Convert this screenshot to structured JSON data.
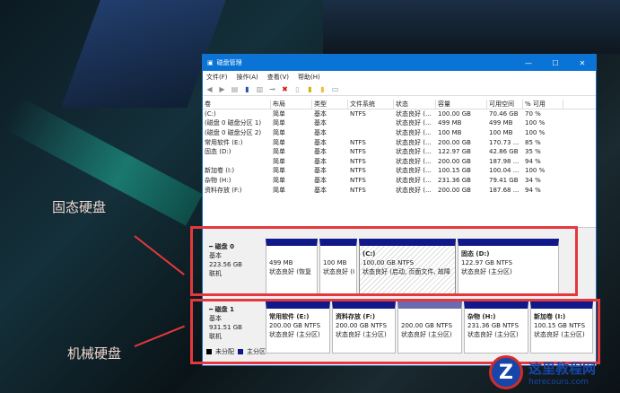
{
  "window": {
    "title": "磁盘管理",
    "controls": [
      "—",
      "☐",
      "✕"
    ]
  },
  "menu": [
    "文件(F)",
    "操作(A)",
    "查看(V)",
    "帮助(H)"
  ],
  "columns": [
    "卷",
    "布局",
    "类型",
    "文件系统",
    "状态",
    "容量",
    "可用空间",
    "% 可用"
  ],
  "volumes": [
    [
      "(C:)",
      "简单",
      "基本",
      "NTFS",
      "状态良好 (...",
      "100.00 GB",
      "70.46 GB",
      "70 %"
    ],
    [
      "(磁盘 0 磁盘分区 1)",
      "简单",
      "基本",
      "",
      "状态良好 (...",
      "499 MB",
      "499 MB",
      "100 %"
    ],
    [
      "(磁盘 0 磁盘分区 2)",
      "简单",
      "基本",
      "",
      "状态良好 (...",
      "100 MB",
      "100 MB",
      "100 %"
    ],
    [
      "常用软件 (E:)",
      "简单",
      "基本",
      "NTFS",
      "状态良好 (...",
      "200.00 GB",
      "170.73 ...",
      "85 %"
    ],
    [
      "固态 (D:)",
      "简单",
      "基本",
      "NTFS",
      "状态良好 (...",
      "122.97 GB",
      "42.86 GB",
      "35 %"
    ],
    [
      "",
      "简单",
      "基本",
      "NTFS",
      "状态良好 (...",
      "200.00 GB",
      "187.98 ...",
      "94 %"
    ],
    [
      "新加卷 (I:)",
      "简单",
      "基本",
      "NTFS",
      "状态良好 (...",
      "100.15 GB",
      "100.04 ...",
      "100 %"
    ],
    [
      "杂物 (H:)",
      "简单",
      "基本",
      "NTFS",
      "状态良好 (...",
      "231.36 GB",
      "79.41 GB",
      "34 %"
    ],
    [
      "资料存放 (F:)",
      "简单",
      "基本",
      "NTFS",
      "状态良好 (...",
      "200.00 GB",
      "187.68 ...",
      "94 %"
    ]
  ],
  "disk0": {
    "name": "磁盘 0",
    "type": "基本",
    "size": "223.56 GB",
    "status": "联机",
    "parts": [
      {
        "name": "",
        "size": "499 MB",
        "status": "状态良好 (恢复"
      },
      {
        "name": "",
        "size": "100 MB",
        "status": "状态良好 (I"
      },
      {
        "name": "(C:)",
        "size": "100.00 GB NTFS",
        "status": "状态良好 (启动, 页面文件, 故障"
      },
      {
        "name": "固态  (D:)",
        "size": "122.97 GB NTFS",
        "status": "状态良好 (主分区)"
      }
    ]
  },
  "disk1": {
    "name": "磁盘 1",
    "type": "基本",
    "size": "931.51 GB",
    "status": "联机",
    "parts": [
      {
        "name": "常用软件  (E:)",
        "size": "200.00 GB NTFS",
        "status": "状态良好 (主分区)"
      },
      {
        "name": "资料存放  (F:)",
        "size": "200.00 GB NTFS",
        "status": "状态良好 (主分区)"
      },
      {
        "name": "",
        "size": "200.00 GB NTFS",
        "status": "状态良好 (主分区)"
      },
      {
        "name": "杂物  (H:)",
        "size": "231.36 GB NTFS",
        "status": "状态良好 (主分区)"
      },
      {
        "name": "新加卷  (I:)",
        "size": "100.15 GB NTFS",
        "status": "状态良好 (主分区)"
      }
    ]
  },
  "legend": [
    "未分配",
    "主分区"
  ],
  "annotations": {
    "ssd": "固态硬盘",
    "hdd": "机械硬盘"
  },
  "logo": {
    "name": "这里教程网",
    "url": "herecours.com"
  }
}
